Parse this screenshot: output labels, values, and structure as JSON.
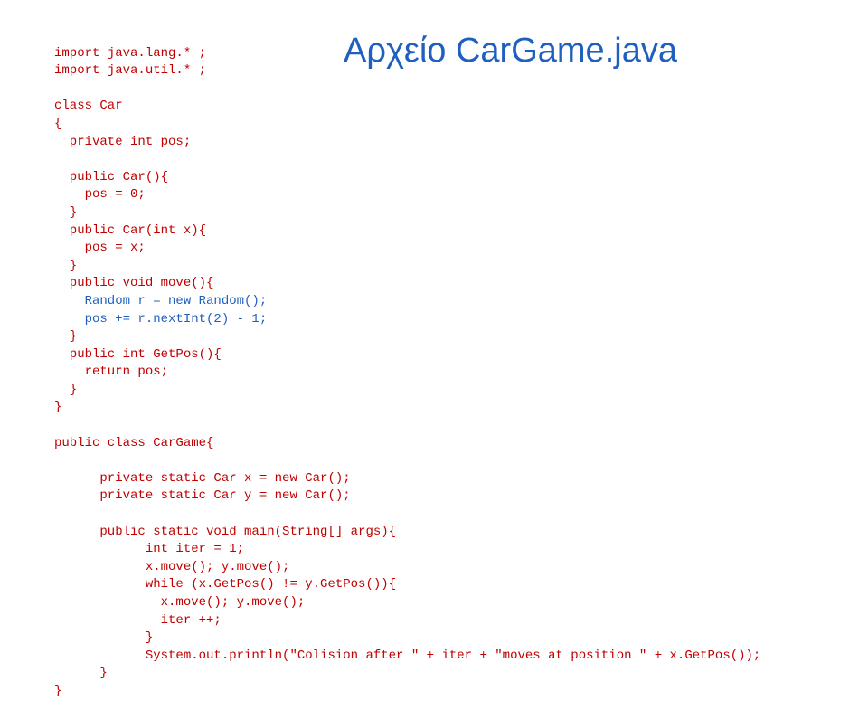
{
  "title": "Αρχείο CarGame.java",
  "code": {
    "line1": "import java.lang.* ;",
    "line2": "import java.util.* ;",
    "line3": "",
    "line4": "class Car",
    "line5": "{",
    "line6": "  private int pos;",
    "line7": "",
    "line8": "  public Car(){",
    "line9": "    pos = 0;",
    "line10": "  }",
    "line11": "  public Car(int x){",
    "line12": "    pos = x;",
    "line13": "  }",
    "line14": "  public void move(){",
    "line15a": "    Random r = new Random();",
    "line15b": "    pos += r.nextInt(2) - 1;",
    "line16": "  }",
    "line17": "  public int GetPos(){",
    "line18": "    return pos;",
    "line19": "  }",
    "line20": "}",
    "line21": "",
    "line22": "public class CarGame{",
    "line23": "",
    "line24": "      private static Car x = new Car();",
    "line25": "      private static Car y = new Car();",
    "line26": "",
    "line27": "      public static void main(String[] args){",
    "line28": "            int iter = 1;",
    "line29": "            x.move(); y.move();",
    "line30": "            while (x.GetPos() != y.GetPos()){",
    "line31": "              x.move(); y.move();",
    "line32": "              iter ++;",
    "line33": "            }",
    "line34": "            System.out.println(\"Colision after \" + iter + \"moves at position \" + x.GetPos());",
    "line35": "      }",
    "line36": "}"
  }
}
